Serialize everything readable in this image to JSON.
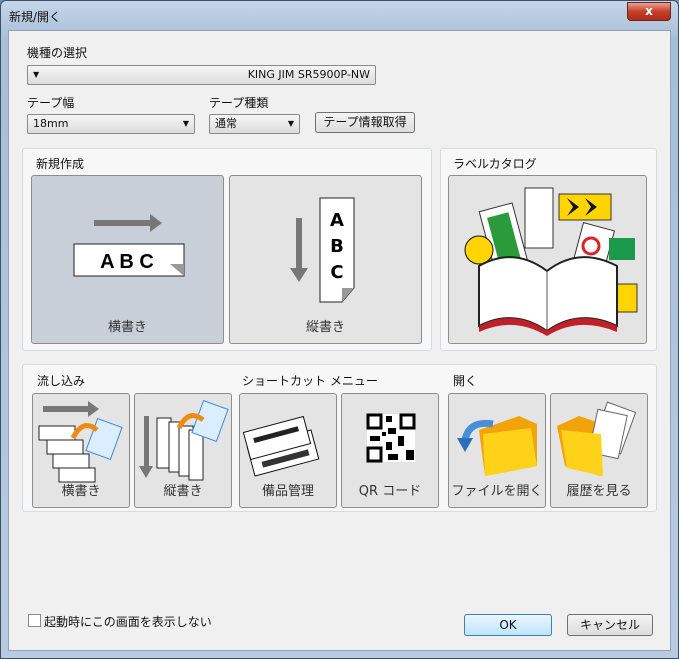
{
  "window": {
    "title": "新規/開く",
    "close_label": "x"
  },
  "model": {
    "label": "機種の選択",
    "value": "KING JIM SR5900P-NW"
  },
  "tape_width": {
    "label": "テープ幅",
    "value": "18mm"
  },
  "tape_type": {
    "label": "テープ種類",
    "value": "通常"
  },
  "tape_info_button": "テープ情報取得",
  "new_group": {
    "title": "新規作成",
    "tiles": [
      {
        "label": "横書き",
        "sample": "A B C"
      },
      {
        "label": "縦書き",
        "sample": [
          "A",
          "B",
          "C"
        ]
      }
    ]
  },
  "catalog_group": {
    "title": "ラベルカタログ"
  },
  "flow_group": {
    "title": "流し込み",
    "tiles": [
      {
        "label": "横書き"
      },
      {
        "label": "縦書き"
      }
    ]
  },
  "shortcut_group": {
    "title": "ショートカット メニュー",
    "tiles": [
      {
        "label": "備品管理"
      },
      {
        "label": "QR コード"
      }
    ]
  },
  "open_group": {
    "title": "開く",
    "tiles": [
      {
        "label": "ファイルを開く"
      },
      {
        "label": "履歴を見る"
      }
    ]
  },
  "startup_checkbox": {
    "label": "起動時にこの画面を表示しない",
    "checked": false
  },
  "buttons": {
    "ok": "OK",
    "cancel": "キャンセル"
  },
  "colors": {
    "selected_tile": "#c9cfd8",
    "tile": "#e4e4e4",
    "close": "#c4402a"
  }
}
